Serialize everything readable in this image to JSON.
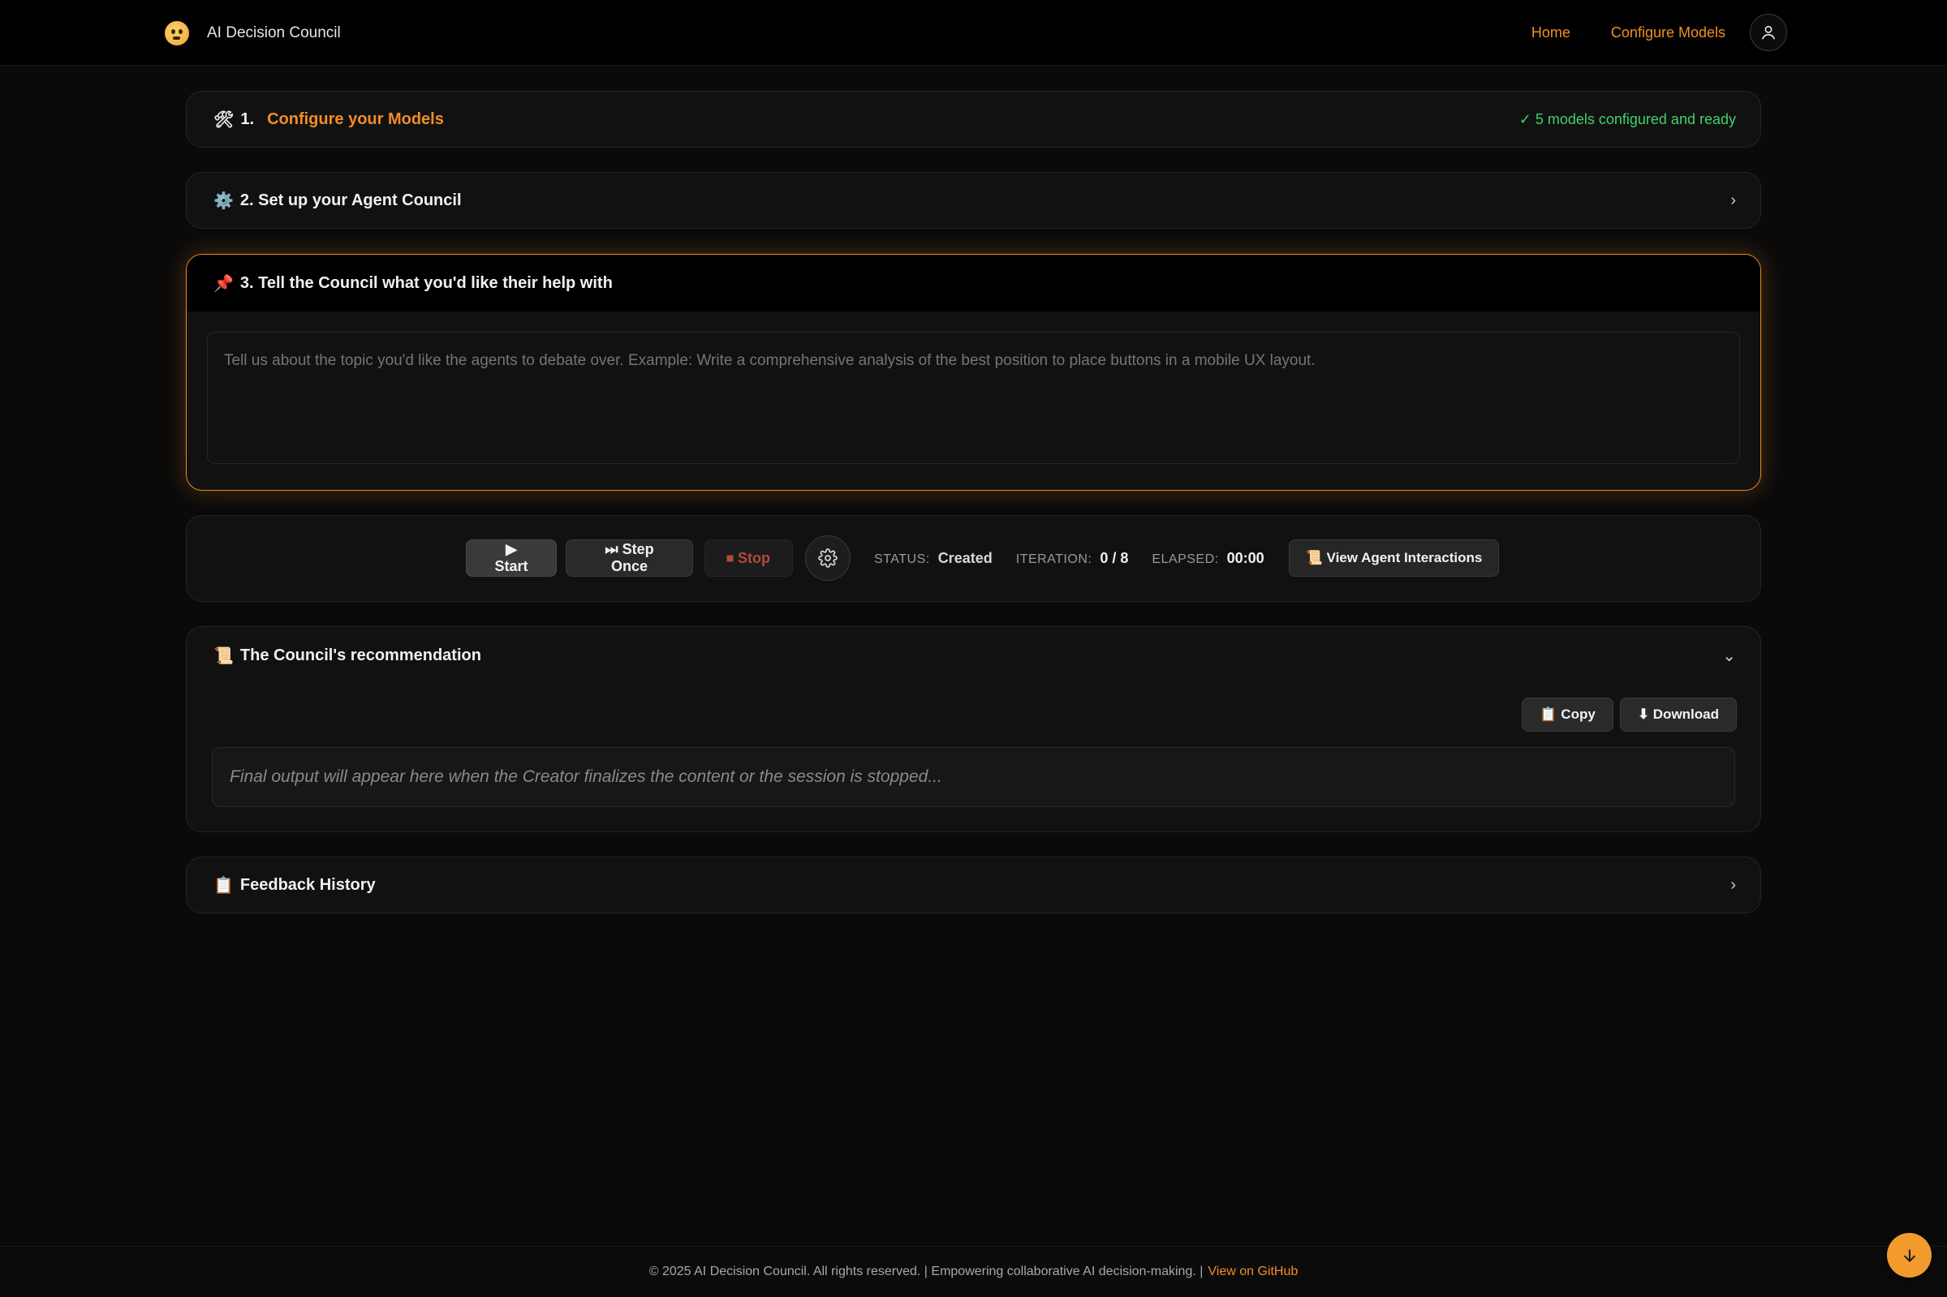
{
  "header": {
    "brand_name": "AI Decision Council",
    "nav": {
      "home": "Home",
      "configure": "Configure Models"
    }
  },
  "step1": {
    "icon": "🛠",
    "number": "1.",
    "title": "Configure your Models",
    "status": "✓ 5 models configured and ready"
  },
  "step2": {
    "icon": "⚙️",
    "title": "2. Set up your Agent Council",
    "chevron": "›"
  },
  "step3": {
    "icon": "📌",
    "title": "3. Tell the Council what you'd like their help with",
    "placeholder": "Tell us about the topic you'd like the agents to debate over. Example: Write a comprehensive analysis of the best position to place buttons in a mobile UX layout."
  },
  "controls": {
    "start": "▶ Start",
    "step_once": "⏭ Step Once",
    "stop": "⏹ Stop",
    "status_label": "STATUS:",
    "status_value": "Created",
    "iteration_label": "ITERATION:",
    "iteration_value": "0 / 8",
    "elapsed_label": "ELAPSED:",
    "elapsed_value": "00:00",
    "view_interactions": "📜 View Agent Interactions"
  },
  "recommendation": {
    "icon": "📜",
    "title": "The Council's recommendation",
    "chevron": "⌄",
    "copy": "📋 Copy",
    "download": "⬇ Download",
    "placeholder": "Final output will appear here when the Creator finalizes the content or the session is stopped..."
  },
  "feedback": {
    "icon": "📋",
    "title": "Feedback History",
    "chevron": "›"
  },
  "footer": {
    "text": "© 2025 AI Decision Council. All rights reserved. | Empowering collaborative AI decision-making. |",
    "link": "View on GitHub"
  },
  "colors": {
    "accent": "#f28c28",
    "ready": "#3fd06a",
    "stop": "#b34a3b",
    "background": "#0a0a0a"
  }
}
